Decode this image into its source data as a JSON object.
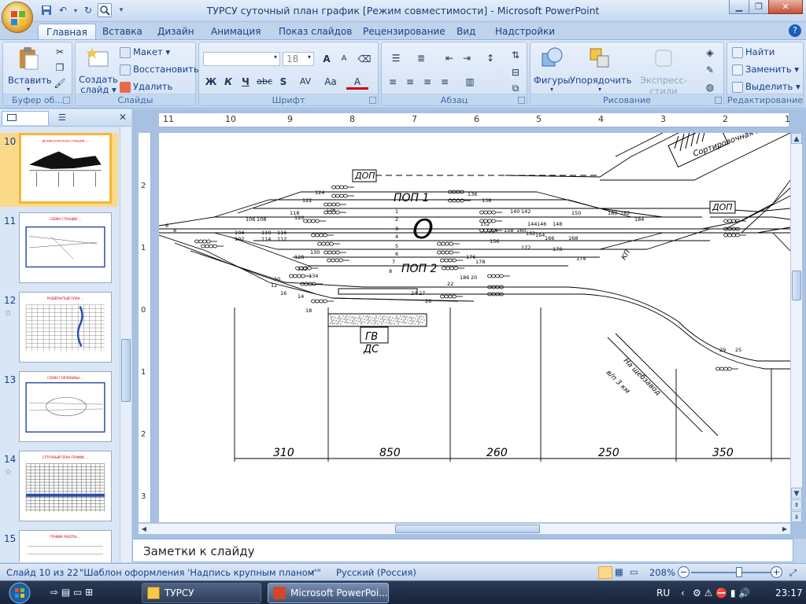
{
  "window": {
    "title": "ТУРСУ суточный план график [Режим совместимости] - Microsoft PowerPoint"
  },
  "tabs": [
    "Главная",
    "Вставка",
    "Дизайн",
    "Анимация",
    "Показ слайдов",
    "Рецензирование",
    "Вид",
    "Надстройки"
  ],
  "ribbon": {
    "clipboard": {
      "paste": "Вставить",
      "label": "Буфер об..."
    },
    "slides": {
      "new_slide": "Создать слайд",
      "layout": "Макет",
      "reset": "Восстановить",
      "delete": "Удалить",
      "label": "Слайды"
    },
    "font": {
      "size": "18",
      "bold": "Ж",
      "italic": "К",
      "underline": "Ч",
      "strike": "abc",
      "shadow": "S",
      "spacing": "AV",
      "case": "Aa",
      "color": "A",
      "grow": "A",
      "shrink": "A",
      "label": "Шрифт"
    },
    "paragraph": {
      "label": "Абзац"
    },
    "drawing": {
      "shapes": "Фигуры",
      "arrange": "Упорядочить",
      "styles": "Экспресс-стили",
      "label": "Рисование"
    },
    "editing": {
      "find": "Найти",
      "replace": "Заменить",
      "select": "Выделить",
      "label": "Редактирование"
    }
  },
  "slides_pane": {
    "thumbs": [
      {
        "num": "10",
        "selected": true,
        "anim": false,
        "caption": "ВЕЛИКОЛУКСКАЯ СТАНЦИЯ ..."
      },
      {
        "num": "11",
        "selected": false,
        "anim": false,
        "caption": "СХЕМА СТАНЦИИ ..."
      },
      {
        "num": "12",
        "selected": false,
        "anim": true,
        "caption": "РАЗВЁРНУТЫЙ ПЛАН ..."
      },
      {
        "num": "13",
        "selected": false,
        "anim": false,
        "caption": "СХЕМА ГОРЛОВИНЫ ..."
      },
      {
        "num": "14",
        "selected": false,
        "anim": true,
        "caption": "СУТОЧНЫЙ ПЛАН-ГРАФИК ..."
      },
      {
        "num": "15",
        "selected": false,
        "anim": false,
        "caption": "ГРАФИК РАБОТЫ ..."
      }
    ]
  },
  "rulers": {
    "horizontal": [
      "11",
      "10",
      "9",
      "8",
      "7",
      "6",
      "5",
      "4",
      "3",
      "2",
      "1"
    ],
    "vertical": [
      "2",
      "1",
      "0",
      "1",
      "2",
      "3"
    ]
  },
  "diagram": {
    "labels": {
      "dop_left": "ДОП",
      "pop1": "ПОП 1",
      "pop2": "ПОП 2",
      "park_o": "О",
      "gv": "ГВ",
      "ds": "ДС",
      "dop_right": "ДОП",
      "sort_platform": "Сортировочная платформа",
      "to_gravel": "На щебзавод",
      "branch_km": "в/п 3 км",
      "ktsp": "КП"
    },
    "switch_numbers": [
      "122",
      "124",
      "126",
      "106",
      "108",
      "104",
      "102",
      "110",
      "114",
      "116",
      "112",
      "118",
      "120",
      "128",
      "130",
      "132",
      "134",
      "8",
      "6",
      "10",
      "12",
      "14",
      "16",
      "18",
      "136",
      "138",
      "140",
      "142",
      "144",
      "146",
      "148",
      "150",
      "152",
      "154",
      "156",
      "158",
      "160",
      "162",
      "164",
      "166",
      "168",
      "170",
      "172",
      "174",
      "176",
      "178",
      "180",
      "182",
      "184",
      "186",
      "20",
      "22",
      "24",
      "26",
      "27",
      "25",
      "29",
      "31",
      "33",
      "21",
      "23"
    ],
    "track_numbers": [
      "1",
      "2",
      "3",
      "4",
      "5",
      "6",
      "7",
      "8"
    ],
    "distances": [
      "310",
      "850",
      "260",
      "250",
      "350"
    ]
  },
  "notes": {
    "placeholder": "Заметки к слайду"
  },
  "status": {
    "slide": "Слайд 10 из 22",
    "theme": "\"Шаблон оформления 'Надпись крупным планом'\"",
    "language": "Русский (Россия)",
    "zoom": "208%"
  },
  "taskbar": {
    "items": [
      "ТУРСУ",
      "Microsoft PowerPoi..."
    ],
    "lang": "RU",
    "time": "23:17"
  }
}
